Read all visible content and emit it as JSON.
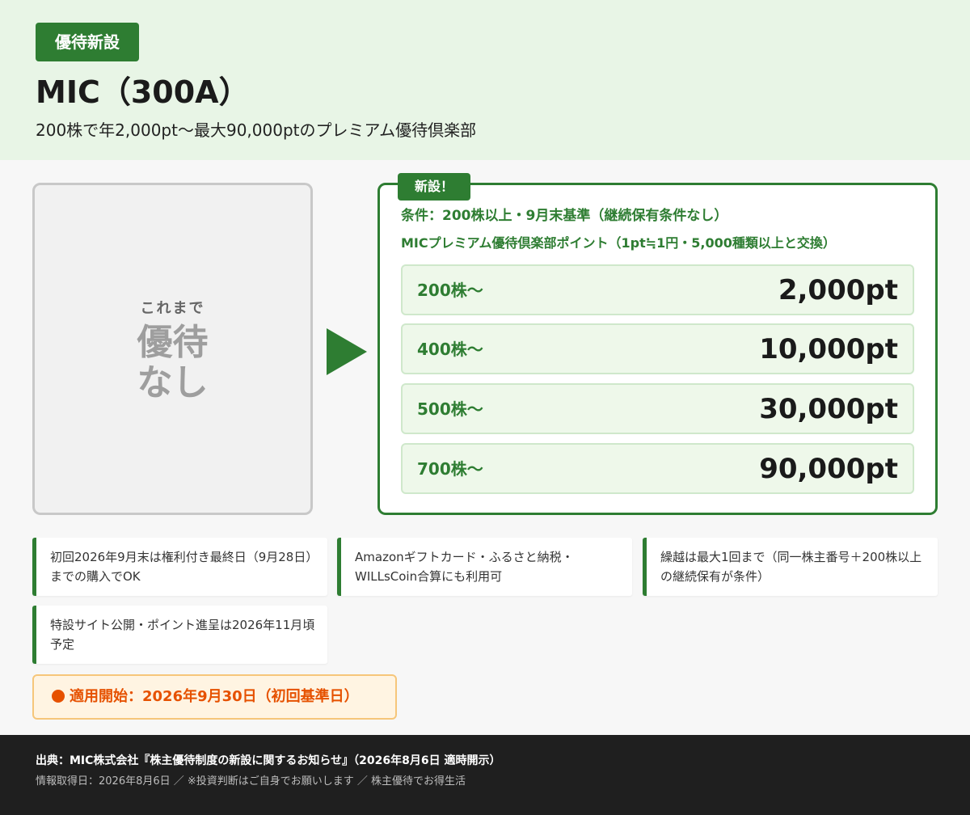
{
  "header": {
    "badge": "優待新設",
    "title": "MIC（300A）",
    "subtitle": "200株で年2,000pt〜最大90,000ptのプレミアム優待倶楽部"
  },
  "before": {
    "label": "これまで",
    "value_line1": "優待",
    "value_line2": "なし"
  },
  "after": {
    "tag": "新設！",
    "condition": "条件：200株以上・9月末基準（継続保有条件なし）",
    "program": "MICプレミアム優待倶楽部ポイント（1pt≒1円・5,000種類以上と交換）",
    "tiers": [
      {
        "shares": "200株〜",
        "points": "2,000pt"
      },
      {
        "shares": "400株〜",
        "points": "10,000pt"
      },
      {
        "shares": "500株〜",
        "points": "30,000pt"
      },
      {
        "shares": "700株〜",
        "points": "90,000pt"
      }
    ]
  },
  "notes": [
    "初回2026年9月末は権利付き最終日（9月28日）までの購入でOK",
    "Amazonギフトカード・ふるさと納税・WILLsCoin合算にも利用可",
    "繰越は最大1回まで（同一株主番号＋200株以上の継続保有が条件）",
    "特設サイト公開・ポイント進呈は2026年11月頃予定"
  ],
  "start": {
    "text": "適用開始：2026年9月30日（初回基準日）",
    "color": "#e65100"
  },
  "footer": {
    "source": "出典：MIC株式会社『株主優待制度の新設に関するお知らせ』（2026年8月6日 適時開示）",
    "disclaimer": "情報取得日：2026年8月6日 ／ ※投資判断はご自身でお願いします ／ 株主優待でお得生活"
  },
  "colors": {
    "brand": "#2e7d32",
    "header_bg": "#e8f5e6",
    "tier_bg": "#eef8ea",
    "footer_bg": "#1f1f1f"
  }
}
